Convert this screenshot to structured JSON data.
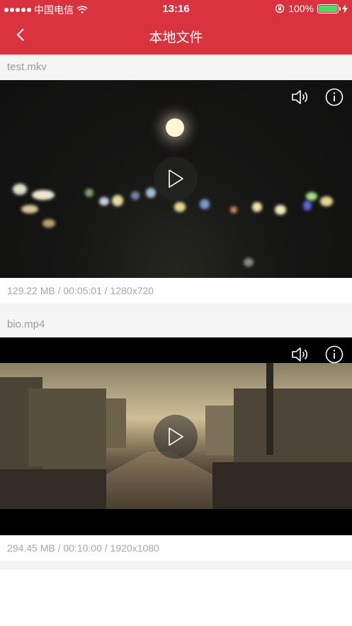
{
  "status_bar": {
    "carrier": "中国电信",
    "time": "13:16",
    "battery": "100%"
  },
  "nav": {
    "title": "本地文件",
    "back_icon": "chevron-left-icon"
  },
  "videos": [
    {
      "name": "test.mkv",
      "info": "129.22 MB / 00:05:01 / 1280x720",
      "icons": [
        "volume-icon",
        "info-icon",
        "play-icon"
      ]
    },
    {
      "name": "bio.mp4",
      "info": "294.45 MB / 00:10:00 / 1920x1080",
      "icons": [
        "volume-icon",
        "info-icon",
        "play-icon"
      ]
    }
  ],
  "colors": {
    "accent": "#d9333f",
    "battery": "#4cd964",
    "meta_text": "#a7a7a7"
  }
}
